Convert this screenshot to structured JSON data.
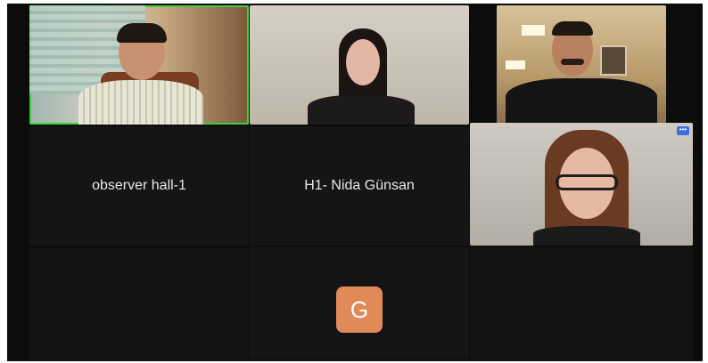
{
  "meeting": {
    "participants": [
      {
        "id": "p1",
        "type": "video",
        "active_speaker": true
      },
      {
        "id": "p2",
        "type": "video"
      },
      {
        "id": "p3",
        "type": "video"
      },
      {
        "id": "p4",
        "name": "observer hall-1",
        "type": "name"
      },
      {
        "id": "p5",
        "name": "H1- Nida Günsan",
        "type": "name"
      },
      {
        "id": "p6",
        "type": "video",
        "menu_label": "•••"
      },
      {
        "id": "p7",
        "avatar_initial": "G",
        "type": "avatar"
      }
    ]
  },
  "colors": {
    "active_speaker_border": "#3bd23b",
    "avatar_bg": "#e08a58",
    "menu_button": "#3d6fe0",
    "background": "#0c0c0c"
  }
}
